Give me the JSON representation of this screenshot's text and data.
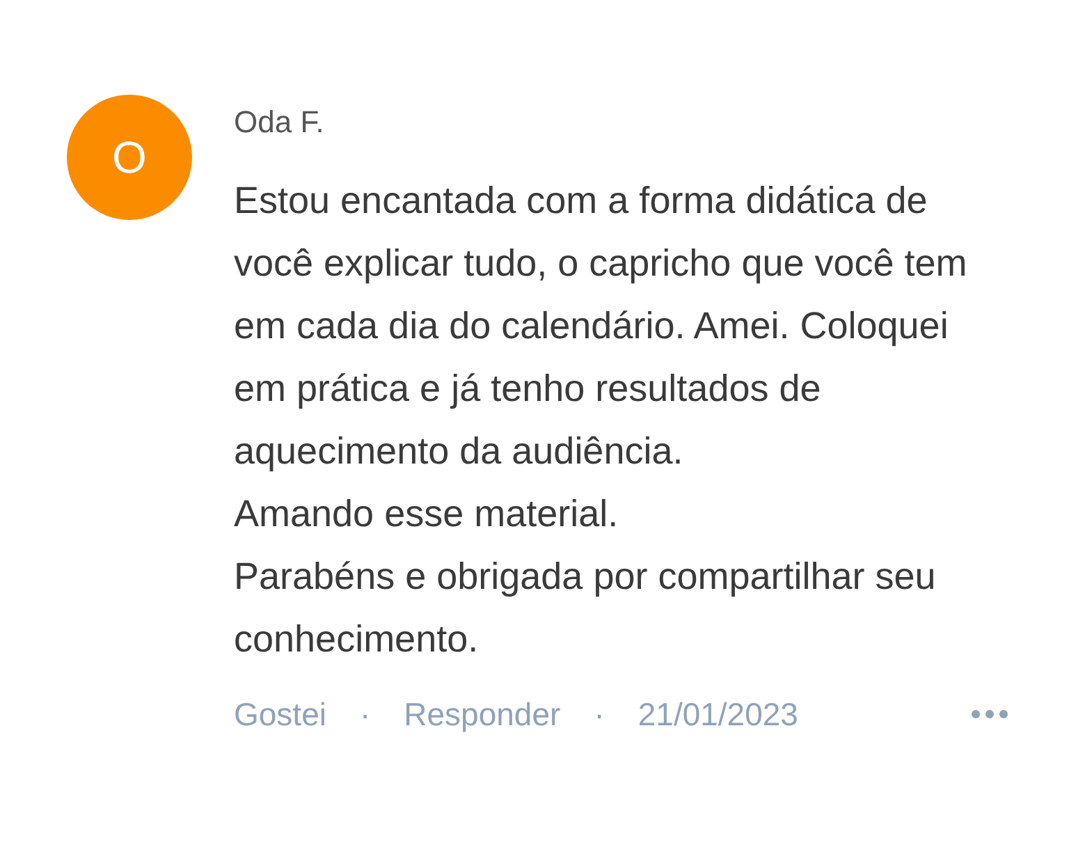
{
  "comment": {
    "avatar_letter": "O",
    "author": "Oda F.",
    "paragraphs": [
      "Estou encantada com a forma didática de você explicar tudo, o capricho que você tem em cada dia do calendário. Amei. Coloquei em prática e já tenho resultados de aquecimento da audiência.",
      "Amando esse material.",
      "Parabéns e obrigada por compartilhar seu conhecimento."
    ],
    "actions": [
      {
        "label": "Gostei"
      },
      {
        "label": "Responder"
      }
    ],
    "separators": [
      "·",
      "·"
    ],
    "date": "21/01/2023"
  }
}
